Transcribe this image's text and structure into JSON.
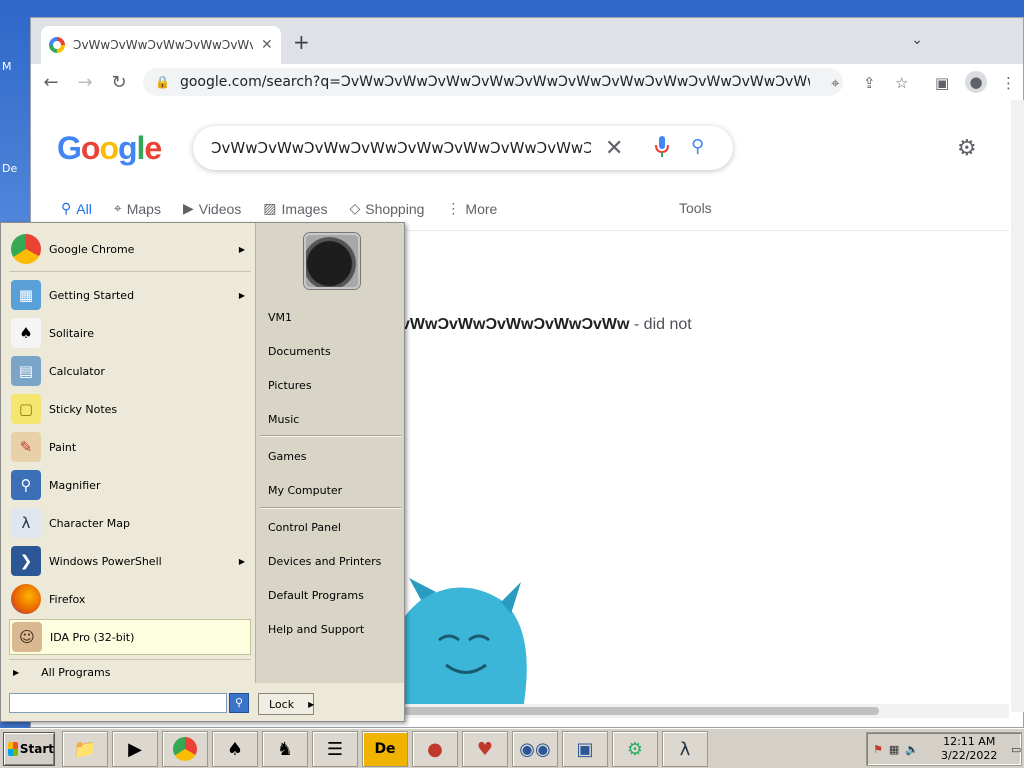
{
  "desktop": {
    "stub_labels": [
      "M",
      "De"
    ]
  },
  "browser": {
    "tab_title": "ƆvWwƆvWwƆvWwƆvWwƆvWv",
    "url": "google.com/search?q=ƆvWwƆvWwƆvWwƆvWwƆvWwƆvWwƆvWwƆvWwƆvWwƆvWwƆvWwƆvW..."
  },
  "google": {
    "logo": "Google",
    "query": "ƆvWwƆvWwƆvWwƆvWwƆvWwƆvWwƆvWwƆvWwƆv",
    "tabs": [
      {
        "label": "All",
        "icon": "search-icon",
        "active": true
      },
      {
        "label": "Maps",
        "icon": "map-pin-icon"
      },
      {
        "label": "Videos",
        "icon": "video-icon"
      },
      {
        "label": "Images",
        "icon": "image-icon"
      },
      {
        "label": "Shopping",
        "icon": "tag-icon"
      },
      {
        "label": "More",
        "icon": "kebab-icon"
      }
    ],
    "tools_label": "Tools",
    "result_query": "vWwƆvWwƆvWwƆvWwƆvWw",
    "result_suffix": " - did not"
  },
  "start_menu": {
    "programs": [
      {
        "label": "Google Chrome",
        "icon": "chrome-icon",
        "submenu": true
      },
      {
        "label": "Getting Started",
        "icon": "getting-started-icon",
        "submenu": true
      },
      {
        "label": "Solitaire",
        "icon": "solitaire-icon"
      },
      {
        "label": "Calculator",
        "icon": "calculator-icon"
      },
      {
        "label": "Sticky Notes",
        "icon": "sticky-notes-icon"
      },
      {
        "label": "Paint",
        "icon": "paint-icon"
      },
      {
        "label": "Magnifier",
        "icon": "magnifier-icon"
      },
      {
        "label": "Character Map",
        "icon": "character-map-icon"
      },
      {
        "label": "Windows PowerShell",
        "icon": "powershell-icon",
        "submenu": true
      },
      {
        "label": "Firefox",
        "icon": "firefox-icon"
      },
      {
        "label": "IDA Pro (32-bit)",
        "icon": "ida-pro-icon",
        "highlighted": true
      }
    ],
    "all_programs": "All Programs",
    "right_links": [
      "VM1",
      "Documents",
      "Pictures",
      "Music",
      "Games",
      "My Computer",
      "Control Panel",
      "Devices and Printers",
      "Default Programs",
      "Help and Support"
    ],
    "search_value": "",
    "lock_label": "Lock"
  },
  "taskbar": {
    "start_label": "Start",
    "time": "12:11 AM",
    "date": "3/22/2022",
    "pinned": [
      "explorer-icon",
      "media-player-icon",
      "chrome-icon",
      "solitaire-icon",
      "chess-icon",
      "list-icon",
      "de-app-icon",
      "dragon-app-icon",
      "hearts-icon",
      "eyes-icon",
      "monitor-icon",
      "network-icon",
      "character-map-icon"
    ]
  }
}
